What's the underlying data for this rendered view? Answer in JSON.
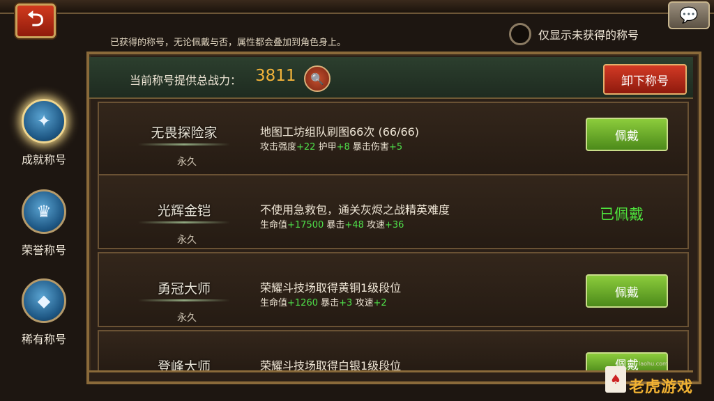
{
  "header": {
    "back_icon": "back-arrow-icon",
    "chat_icon": "chat-bubble-icon",
    "hint": "已获得的称号，无论佩戴与否，属性都会叠加到角色身上。",
    "toggle_label": "仅显示未获得的称号"
  },
  "sidebar": {
    "tabs": [
      {
        "label": "成就称号",
        "icon": "achievement-medal-icon",
        "active": true
      },
      {
        "label": "荣誉称号",
        "icon": "honor-crown-medal-icon",
        "active": false
      },
      {
        "label": "稀有称号",
        "icon": "rare-crystal-medal-icon",
        "active": false
      }
    ]
  },
  "power": {
    "label": "当前称号提供总战力：",
    "value": "3811",
    "search_icon": "magnifier-icon",
    "unequip_label": "卸下称号"
  },
  "titles": [
    {
      "name": "无畏探险家",
      "duration": "永久",
      "condition": "地图工坊组队刷图66次 (66/66)",
      "attrs": [
        {
          "k": "攻击强度",
          "v": "+22"
        },
        {
          "k": "护甲",
          "v": "+8"
        },
        {
          "k": "暴击伤害",
          "v": "+5"
        }
      ],
      "action": "佩戴"
    },
    {
      "name": "光辉金铠",
      "duration": "永久",
      "condition": "不使用急救包，通关灰烬之战精英难度",
      "attrs": [
        {
          "k": "生命值",
          "v": "+17500"
        },
        {
          "k": "暴击",
          "v": "+48"
        },
        {
          "k": "攻速",
          "v": "+36"
        }
      ],
      "action": "已佩戴"
    },
    {
      "name": "勇冠大师",
      "duration": "永久",
      "condition": "荣耀斗技场取得黄铜1级段位",
      "attrs": [
        {
          "k": "生命值",
          "v": "+1260"
        },
        {
          "k": "暴击",
          "v": "+3"
        },
        {
          "k": "攻速",
          "v": "+2"
        }
      ],
      "action": "佩戴"
    },
    {
      "name": "登峰大师",
      "condition": "荣耀斗技场取得白银1级段位",
      "action": "佩戴"
    }
  ],
  "watermark": {
    "site": "laohu.com",
    "name": "老虎游戏"
  },
  "colors": {
    "accent_gold": "#f2b33a",
    "attr_green": "#4fe04a",
    "equip_green": "#6aa82a",
    "unequip_red": "#c0301c"
  }
}
